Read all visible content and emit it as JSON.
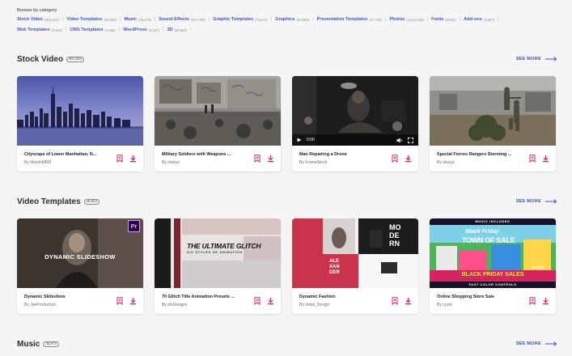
{
  "browse": {
    "title": "Browse by category",
    "row1": [
      {
        "label": "Stock Video",
        "count": "(901,934)"
      },
      {
        "label": "Video Templates",
        "count": "(35,654)"
      },
      {
        "label": "Music",
        "count": "(35,973)"
      },
      {
        "label": "Sound Effects",
        "count": "(347,780)"
      },
      {
        "label": "Graphic Templates",
        "count": "(74,672)"
      },
      {
        "label": "Graphics",
        "count": "(83,693)"
      },
      {
        "label": "Presentation Templates",
        "count": "(37,720)"
      },
      {
        "label": "Photos",
        "count": "(1,222,069)"
      },
      {
        "label": "Fonts",
        "count": "(8,552)"
      },
      {
        "label": "Add-ons",
        "count": "(2,687)"
      }
    ],
    "row2": [
      {
        "label": "Web Templates",
        "count": "(3,624)"
      },
      {
        "label": "CMS Templates",
        "count": "(1,096)"
      },
      {
        "label": "WordPress",
        "count": "(2,197)"
      },
      {
        "label": "3D",
        "count": "(20,892)"
      }
    ]
  },
  "see_more_label": "SEE MORE",
  "sections": [
    {
      "title": "Stock Video",
      "count": "901,934",
      "cards": [
        {
          "title": "Cityscape of Lower Manhattan, N...",
          "author": "By Maxim8409",
          "thumb": "city"
        },
        {
          "title": "Military Soldiers with Weapons ...",
          "author": "By stasya",
          "thumb": "ruins"
        },
        {
          "title": "Man Repairing a Drone",
          "author": "By FrameStock",
          "thumb": "drone",
          "player_time": "0:00"
        },
        {
          "title": "Special Forces Rangers Storming ...",
          "author": "By stasya",
          "thumb": "forces"
        }
      ]
    },
    {
      "title": "Video Templates",
      "count": "35,654",
      "cards": [
        {
          "title": "Dynamic Slideshow",
          "author": "By JoeProduction",
          "thumb": "slideshow",
          "overlay": "DYNAMIC SLIDESHOW",
          "badge": "Pr"
        },
        {
          "title": "70 Glitch Title Animation Presets ...",
          "author": "By sfxDesigns",
          "thumb": "glitch",
          "overlay": "THE ULTIMATE GLITCH",
          "overlay2": "SIX STYLES OF ANIMATION"
        },
        {
          "title": "Dynamic Fashion",
          "author": "By Initial_Design",
          "thumb": "fashion",
          "overlay": [
            "MO",
            "DE",
            "RN"
          ],
          "overlay2": [
            "ALE",
            "XAN",
            "DER"
          ]
        },
        {
          "title": "Online Shopping Store Sale",
          "author": "By cyzer",
          "thumb": "shop",
          "overlay": "Black Friday",
          "overlay2": "TOWN OF SALE",
          "overlay3": "BLACK FRIDAY SALES",
          "overlay4": "MUSIC INCLUDED",
          "overlay5": "FAST COLOR CONTROLS",
          "overlay6": "envato"
        }
      ]
    },
    {
      "title": "Music",
      "count": "35,973"
    }
  ],
  "colors": {
    "accent": "#3f51b5",
    "link": "#4155c2",
    "action_pink": "#e0245e",
    "page_bg": "#f5f5f6"
  }
}
